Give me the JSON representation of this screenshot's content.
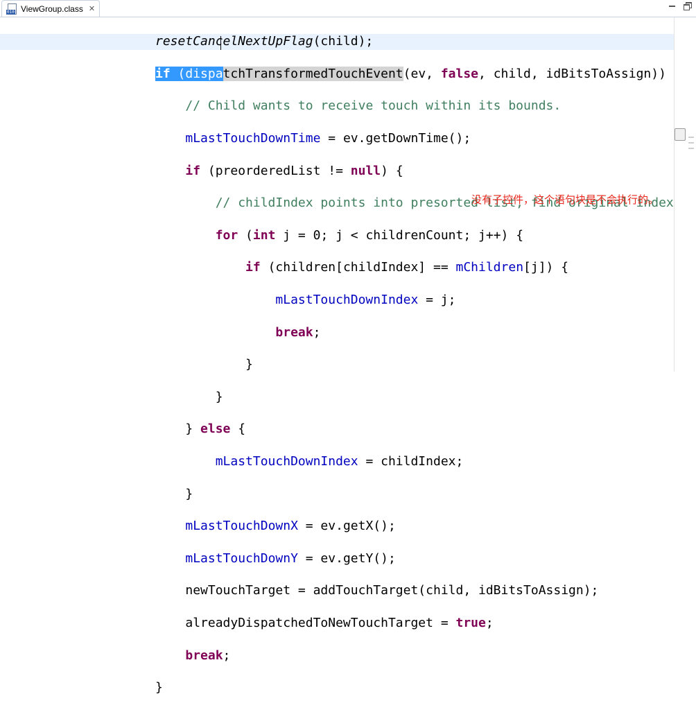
{
  "tab": {
    "title": "ViewGroup.class",
    "close_glyph": "✕"
  },
  "code": {
    "line1": "resetCancelNextUpFlag",
    "line1_rest": "(child);",
    "line2_kw_if": "if",
    "line2_sel_rest": " (dispa",
    "line2_occ": "tchTransformedTouchEvent",
    "line2_a": "(ev, ",
    "line2_kw_false": "false",
    "line2_b": ", child, idBitsToAssign)) {",
    "line3_comment": "// Child wants to receive touch within its bounds.",
    "line4_field": "mLastTouchDownTime",
    "line4_rest": " = ev.getDownTime();",
    "line5_kw_if": "if",
    "line5_a": " (preorderedList != ",
    "line5_kw_null": "null",
    "line5_b": ") {",
    "line6_comment": "// childIndex points into presorted list, find original index",
    "line7_kw_for": "for",
    "line7_a": " (",
    "line7_kw_int": "int",
    "line7_b": " j = 0; j < childrenCount; j++) {",
    "line8_kw_if": "if",
    "line8_a": " (children[childIndex] == ",
    "line8_field": "mChildren",
    "line8_b": "[j]) {",
    "line9_field": "mLastTouchDownIndex",
    "line9_rest": " = j;",
    "line10_kw_break": "break",
    "line10_rest": ";",
    "line11": "}",
    "line12": "}",
    "line13_a": "} ",
    "line13_kw_else": "else",
    "line13_b": " {",
    "line14_field": "mLastTouchDownIndex",
    "line14_rest": " = childIndex;",
    "line15": "}",
    "line16_field": "mLastTouchDownX",
    "line16_rest": " = ev.getX();",
    "line17_field": "mLastTouchDownY",
    "line17_rest": " = ev.getY();",
    "line18": "newTouchTarget = addTouchTarget(child, idBitsToAssign);",
    "line19_a": "alreadyDispatchedToNewTouchTarget = ",
    "line19_kw_true": "true",
    "line19_b": ";",
    "line20_kw_break": "break",
    "line20_rest": ";",
    "line21": "}"
  },
  "annotation": {
    "text": "没有子控件，这个语句块是不会执行的。",
    "color": "#e8281e"
  },
  "colors": {
    "keyword": "#7f0055",
    "field": "#0000c0",
    "comment": "#3f7f5f",
    "selection": "#3399ff",
    "current_line": "#e8f2fe"
  }
}
